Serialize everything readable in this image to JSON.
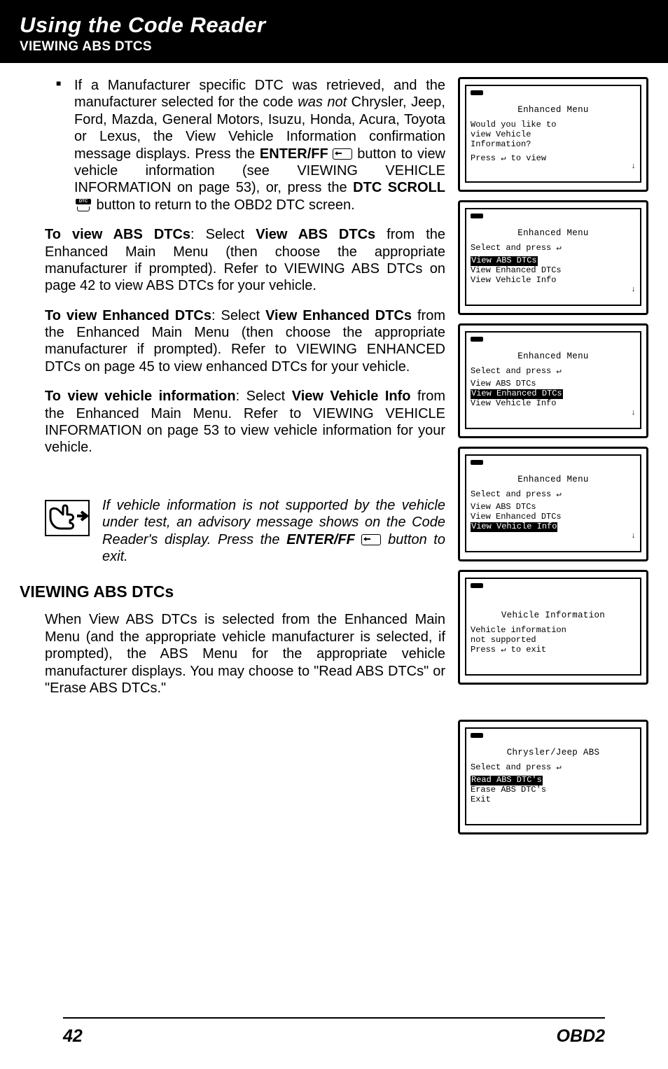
{
  "header": {
    "title": "Using the Code Reader",
    "subtitle": "VIEWING ABS DTCS"
  },
  "body": {
    "bullet_p1": "If a Manufacturer specific DTC was retrieved, and the manufacturer selected for the code ",
    "bullet_i1": "was not",
    "bullet_p2": " Chrysler, Jeep, Ford, Mazda, General Motors, Isuzu, Honda, Acura, Toyota or Lexus, the View Vehicle Information confirmation message displays. Press the ",
    "bullet_b1": "ENTER/FF",
    "bullet_p3": " button to view vehicle information (see VIEWING VEHICLE INFORMATION on page 53), or, press the ",
    "bullet_b2": "DTC SCROLL",
    "bullet_p4": " button to return to the OBD2 DTC screen.",
    "p2_a": "To view ABS DTCs",
    "p2_b": ": Select ",
    "p2_c": "View ABS DTCs",
    "p2_d": " from the Enhanced Main Menu (then choose the appropriate manufacturer if prompted). Refer to VIEWING ABS DTCs on page 42 to view ABS DTCs for your vehicle.",
    "p3_a": "To view Enhanced DTCs",
    "p3_b": ": Select ",
    "p3_c": "View Enhanced DTCs",
    "p3_d": " from the Enhanced Main Menu (then choose the appropriate manufacturer if prompted). Refer to VIEWING ENHANCED DTCs on page 45 to view enhanced DTCs for your vehicle.",
    "p4_a": "To view vehicle information",
    "p4_b": ": Select ",
    "p4_c": "View Vehicle Info",
    "p4_d": " from the Enhanced Main Menu. Refer to VIEWING VEHICLE INFORMATION on page 53 to view vehicle information for your vehicle.",
    "note_a": "If vehicle information is not supported by the vehicle under test, an advisory message shows on the Code Reader's display. Press the ",
    "note_b": "ENTER/FF",
    "note_c": " button to exit.",
    "section_heading": "VIEWING ABS DTCs",
    "p5": "When View ABS DTCs is selected from the Enhanced Main Menu (and the appropriate vehicle manufacturer is selected, if prompted), the ABS Menu for the appropriate vehicle manufacturer displays. You may choose to \"Read ABS DTCs\" or \"Erase ABS DTCs.\""
  },
  "screens": {
    "s1": {
      "title": "Enhanced Menu",
      "l1": "Would you like to",
      "l2": "view Vehicle",
      "l3": "Information?",
      "l4": "Press ↵ to view"
    },
    "s2": {
      "title": "Enhanced Menu",
      "l1": "Select and press ↵",
      "hl": "View ABS DTCs",
      "l3": "View Enhanced DTCs",
      "l4": "View Vehicle Info"
    },
    "s3": {
      "title": "Enhanced Menu",
      "l1": "Select and press ↵",
      "l2": "View ABS DTCs",
      "hl": "View Enhanced DTCs",
      "l4": "View Vehicle Info"
    },
    "s4": {
      "title": "Enhanced Menu",
      "l1": "Select and press ↵",
      "l2": "View ABS DTCs",
      "l3": "View Enhanced DTCs",
      "hl": "View Vehicle Info"
    },
    "s5": {
      "title": "Vehicle Information",
      "l1": "Vehicle information",
      "l2": "not supported",
      "l3": "Press ↵ to exit"
    },
    "s6": {
      "title": "Chrysler/Jeep ABS",
      "l1": "Select and press ↵",
      "hl": "Read ABS DTC's",
      "l3": "Erase ABS DTC's",
      "l4": "Exit"
    }
  },
  "footer": {
    "left": "42",
    "right": "OBD2"
  }
}
